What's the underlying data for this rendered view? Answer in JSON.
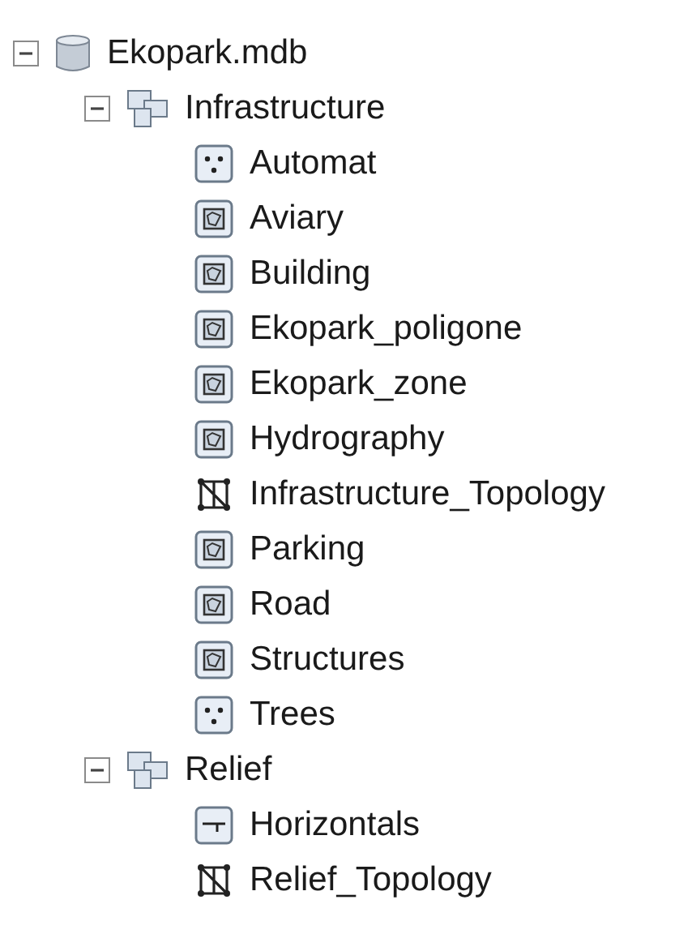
{
  "tree": [
    {
      "label": "Ekopark.mdb",
      "kind": "database",
      "expanded": true,
      "children": [
        {
          "label": "Infrastructure",
          "kind": "dataset",
          "expanded": true,
          "children": [
            {
              "label": "Automat",
              "kind": "point"
            },
            {
              "label": "Aviary",
              "kind": "polygon"
            },
            {
              "label": "Building",
              "kind": "polygon"
            },
            {
              "label": "Ekopark_poligone",
              "kind": "polygon"
            },
            {
              "label": "Ekopark_zone",
              "kind": "polygon"
            },
            {
              "label": "Hydrography",
              "kind": "polygon"
            },
            {
              "label": "Infrastructure_Topology",
              "kind": "topology"
            },
            {
              "label": "Parking",
              "kind": "polygon"
            },
            {
              "label": "Road",
              "kind": "polygon"
            },
            {
              "label": "Structures",
              "kind": "polygon"
            },
            {
              "label": "Trees",
              "kind": "point"
            }
          ]
        },
        {
          "label": "Relief",
          "kind": "dataset",
          "expanded": true,
          "children": [
            {
              "label": "Horizontals",
              "kind": "line"
            },
            {
              "label": "Relief_Topology",
              "kind": "topology"
            }
          ]
        }
      ]
    }
  ]
}
